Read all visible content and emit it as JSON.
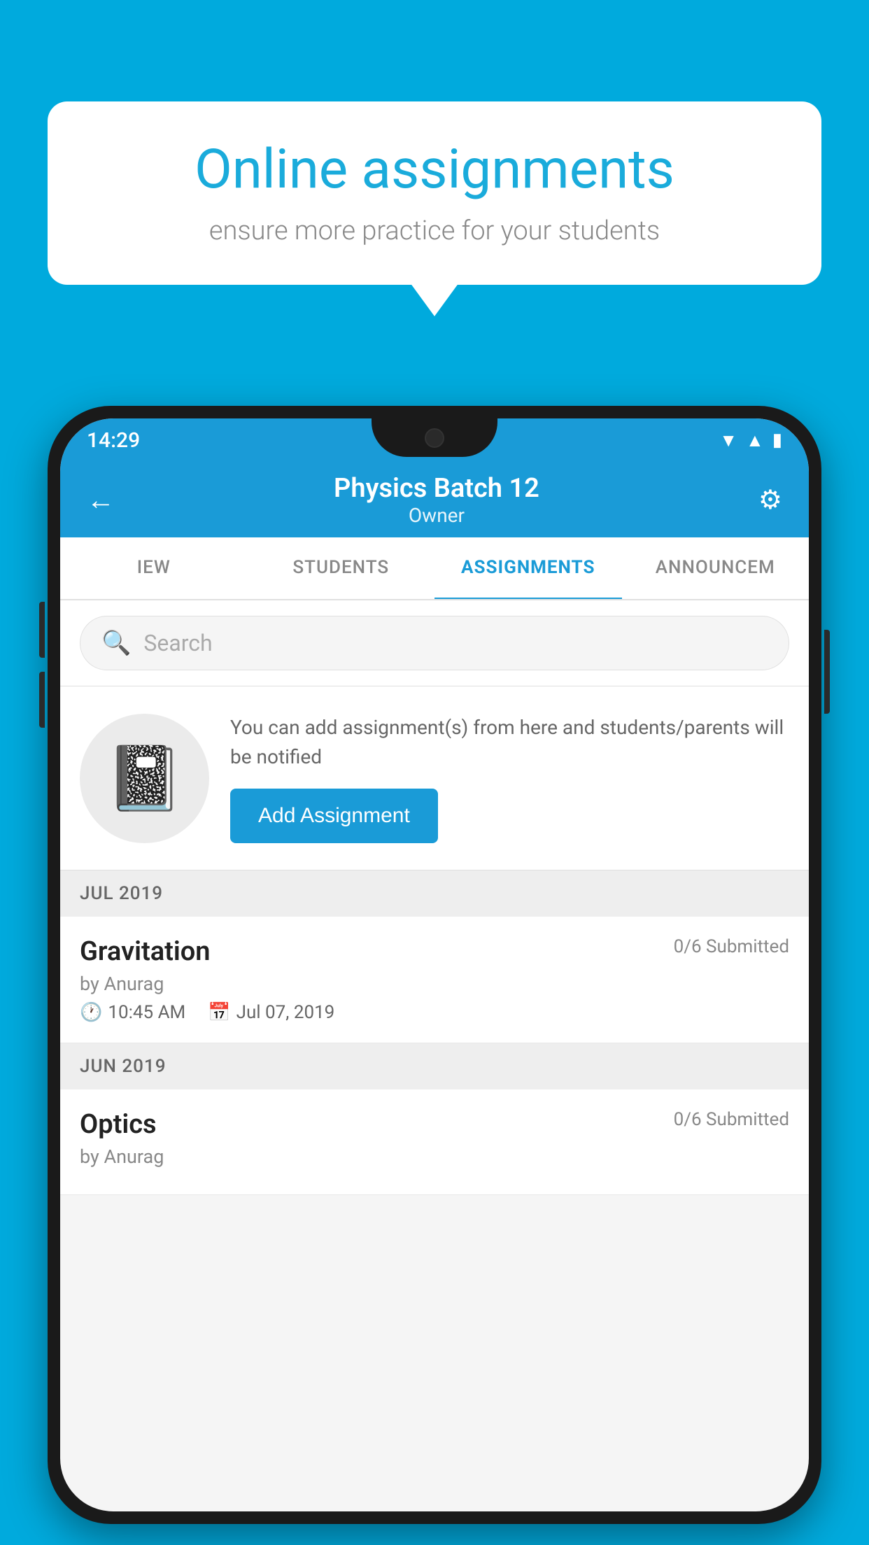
{
  "background_color": "#00AADD",
  "speech_bubble": {
    "title": "Online assignments",
    "subtitle": "ensure more practice for your students"
  },
  "phone": {
    "status_bar": {
      "time": "14:29",
      "icons": [
        "wifi",
        "signal",
        "battery"
      ]
    },
    "header": {
      "title": "Physics Batch 12",
      "subtitle": "Owner",
      "back_label": "←",
      "settings_label": "⚙"
    },
    "tabs": [
      {
        "label": "IEW",
        "active": false
      },
      {
        "label": "STUDENTS",
        "active": false
      },
      {
        "label": "ASSIGNMENTS",
        "active": true
      },
      {
        "label": "ANNOUNCEM",
        "active": false
      }
    ],
    "search": {
      "placeholder": "Search"
    },
    "cta": {
      "description": "You can add assignment(s) from here and students/parents will be notified",
      "button_label": "Add Assignment"
    },
    "sections": [
      {
        "month": "JUL 2019",
        "assignments": [
          {
            "name": "Gravitation",
            "submitted": "0/6 Submitted",
            "author": "by Anurag",
            "time": "10:45 AM",
            "date": "Jul 07, 2019"
          }
        ]
      },
      {
        "month": "JUN 2019",
        "assignments": [
          {
            "name": "Optics",
            "submitted": "0/6 Submitted",
            "author": "by Anurag",
            "time": "",
            "date": ""
          }
        ]
      }
    ]
  }
}
